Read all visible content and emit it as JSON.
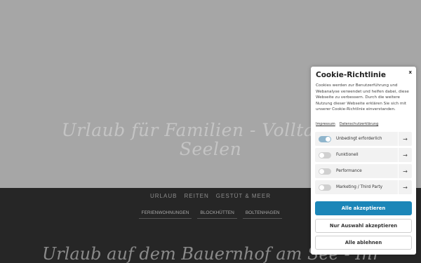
{
  "hero": {
    "title_line1": "Urlaub für Familien - Volltanken",
    "title_line2": "Seelen"
  },
  "nav": {
    "main": [
      "URLAUB",
      "REITEN",
      "GESTÜT & MEER"
    ],
    "sub": [
      "FERIENWOHNUNGEN",
      "BLOCKHÜTTEN",
      "BOLTENHAGEN"
    ]
  },
  "bottom_title": "Urlaub auf dem Bauernhof am See - Ihr",
  "cookie": {
    "title": "Cookie-Richtlinie",
    "close": "x",
    "description": "Cookies werden zur Benutzerführung und Webanalyse verwendet und helfen dabei, diese Webseite zu verbessern. Durch die weitere Nutzung dieser Webseite erklären Sie sich mit unserer Cookie-Richtlinie einverstanden.",
    "links": [
      "Impressum",
      "Datenschutzerklärung"
    ],
    "categories": [
      {
        "label": "Unbedingt erforderlich",
        "enabled": true
      },
      {
        "label": "Funktionell",
        "enabled": false
      },
      {
        "label": "Performance",
        "enabled": false
      },
      {
        "label": "Marketing / Third Party",
        "enabled": false
      }
    ],
    "arrow": "→",
    "buttons": {
      "accept_all": "Alle akzeptieren",
      "accept_selection": "Nur Auswahl akzeptieren",
      "reject_all": "Alle ablehnen"
    },
    "colors": {
      "primary": "#1b86b8",
      "toggle_on": "#8fb5cc"
    }
  }
}
